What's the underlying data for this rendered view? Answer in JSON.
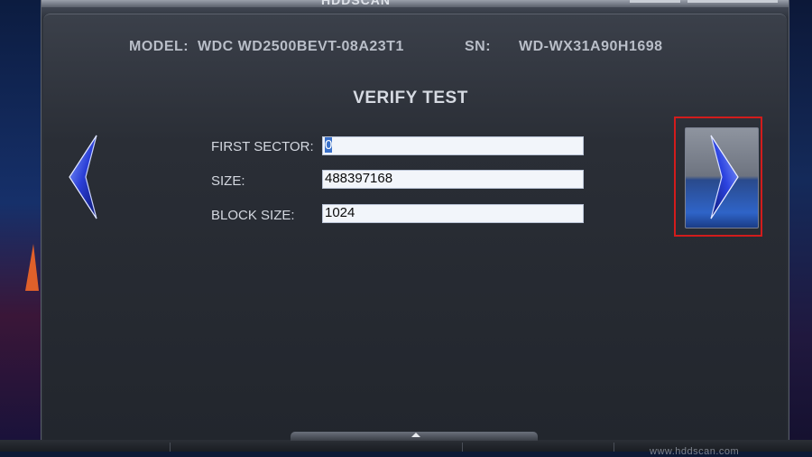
{
  "app": {
    "title": "HDDSCAN"
  },
  "drive": {
    "model_label": "MODEL:",
    "model_value": "WDC WD2500BEVT-08A23T1",
    "sn_label": "SN:",
    "sn_value": "WD-WX31A90H1698"
  },
  "test": {
    "title": "VERIFY TEST",
    "fields": [
      {
        "label": "FIRST SECTOR:",
        "value": "0"
      },
      {
        "label": "SIZE:",
        "value": "488397168"
      },
      {
        "label": "BLOCK SIZE:",
        "value": "1024"
      }
    ]
  },
  "nav": {
    "prev_icon": "chevron-left-icon",
    "next_icon": "chevron-right-icon",
    "next_highlight_color": "#d21c1c"
  },
  "footer": {
    "text": "www.hddscan.com"
  }
}
